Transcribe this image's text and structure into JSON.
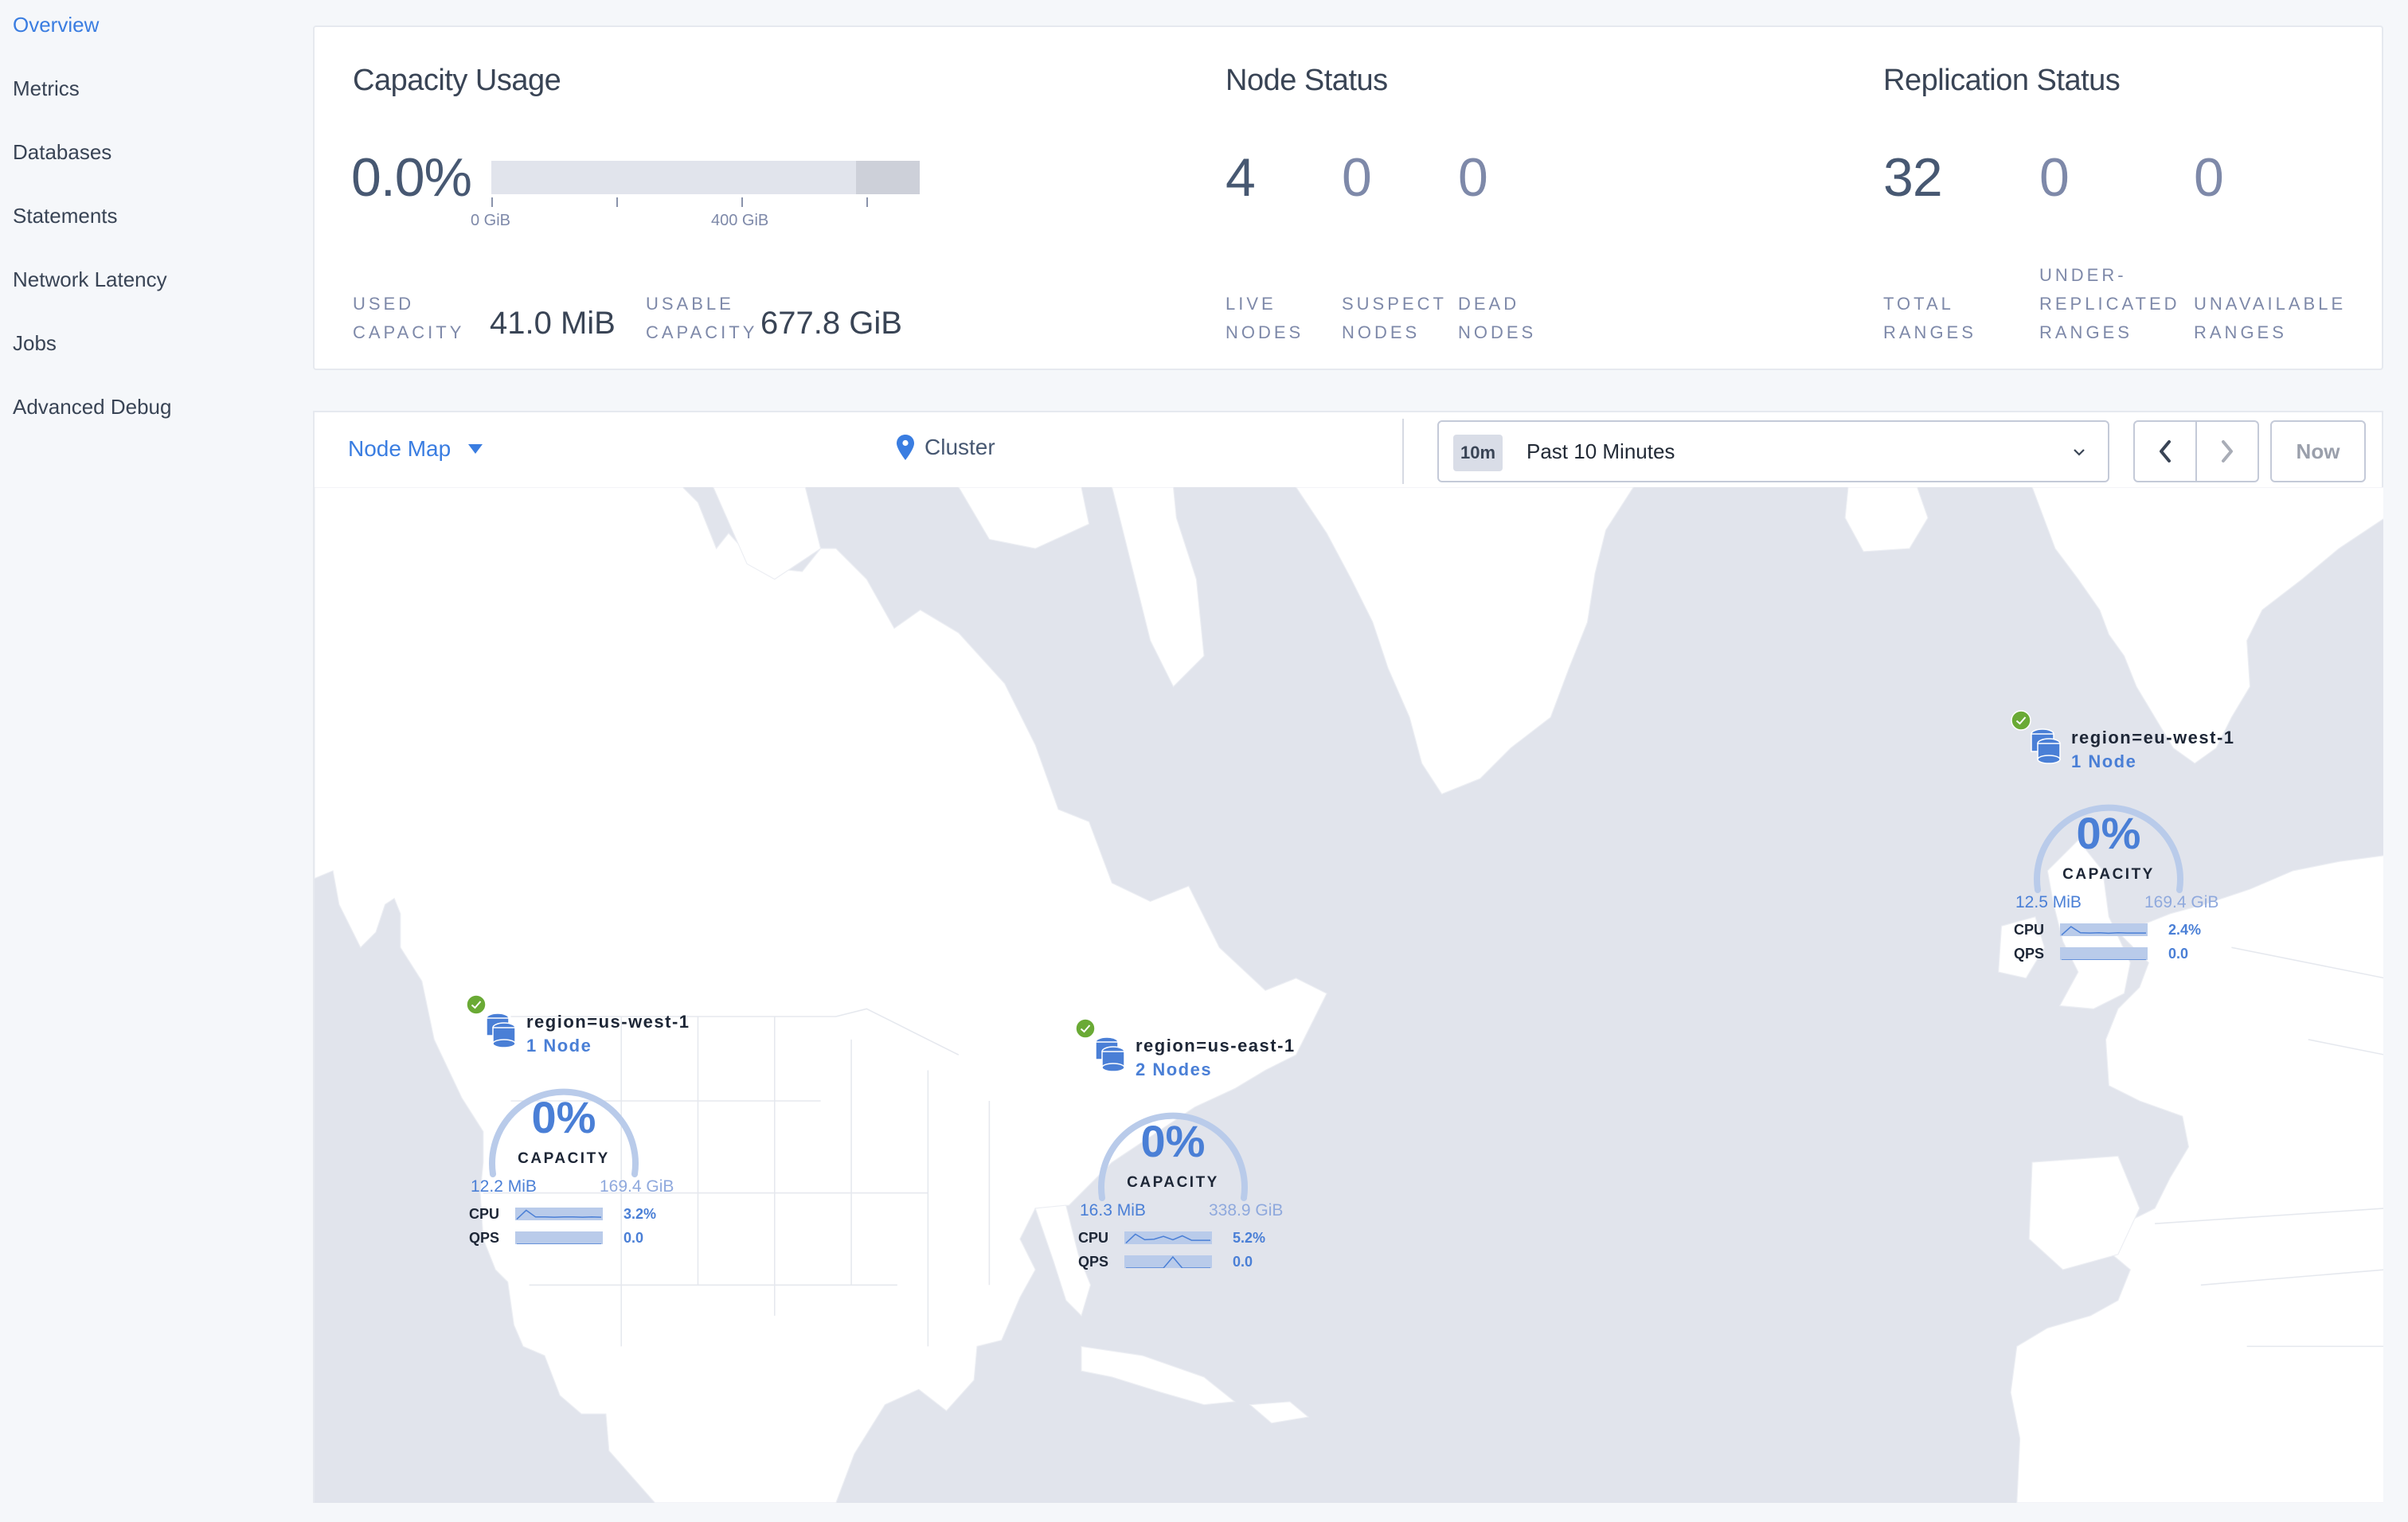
{
  "sidebar": {
    "items": [
      {
        "label": "Overview",
        "active": true
      },
      {
        "label": "Metrics",
        "active": false
      },
      {
        "label": "Databases",
        "active": false
      },
      {
        "label": "Statements",
        "active": false
      },
      {
        "label": "Network Latency",
        "active": false
      },
      {
        "label": "Jobs",
        "active": false
      },
      {
        "label": "Advanced Debug",
        "active": false
      }
    ]
  },
  "capacity": {
    "title": "Capacity Usage",
    "percent": "0.0%",
    "bar_ticks": [
      "0 GiB",
      "400 GiB"
    ],
    "used_label_1": "USED",
    "used_label_2": "CAPACITY",
    "used_value": "41.0 MiB",
    "usable_label_1": "USABLE",
    "usable_label_2": "CAPACITY",
    "usable_value": "677.8 GiB",
    "used_fraction": 0.0
  },
  "node_status": {
    "title": "Node Status",
    "stats": [
      {
        "value": "4",
        "label_1": "LIVE",
        "label_2": "NODES"
      },
      {
        "value": "0",
        "label_1": "SUSPECT",
        "label_2": "NODES"
      },
      {
        "value": "0",
        "label_1": "DEAD",
        "label_2": "NODES"
      }
    ]
  },
  "replication_status": {
    "title": "Replication Status",
    "stats": [
      {
        "value": "32",
        "label_0": "",
        "label_1": "TOTAL",
        "label_2": "RANGES"
      },
      {
        "value": "0",
        "label_0": "UNDER-",
        "label_1": "REPLICATED",
        "label_2": "RANGES"
      },
      {
        "value": "0",
        "label_0": "",
        "label_1": "UNAVAILABLE",
        "label_2": "RANGES"
      }
    ]
  },
  "toolbar": {
    "map_select": "Node Map",
    "breadcrumb": "Cluster",
    "time_badge": "10m",
    "time_label": "Past 10 Minutes",
    "now_label": "Now"
  },
  "regions": [
    {
      "name": "region=us-west-1",
      "nodes": "1 Node",
      "status": "healthy",
      "capacity_pct": "0%",
      "capacity_label": "CAPACITY",
      "used": "12.2 MiB",
      "total": "169.4 GiB",
      "cpu_label": "CPU",
      "cpu": "3.2%",
      "qps_label": "QPS",
      "qps": "0.0",
      "cpu_spark": [
        0.1,
        0.9,
        0.3,
        0.3,
        0.28,
        0.3,
        0.3,
        0.28,
        0.3,
        0.28
      ],
      "qps_spark": [
        0,
        0,
        0,
        0,
        0,
        0,
        0,
        0,
        0,
        0
      ]
    },
    {
      "name": "region=us-east-1",
      "nodes": "2 Nodes",
      "status": "healthy",
      "capacity_pct": "0%",
      "capacity_label": "CAPACITY",
      "used": "16.3 MiB",
      "total": "338.9 GiB",
      "cpu_label": "CPU",
      "cpu": "5.2%",
      "qps_label": "QPS",
      "qps": "0.0",
      "cpu_spark": [
        0.1,
        0.9,
        0.4,
        0.45,
        0.7,
        0.4,
        0.75,
        0.35,
        0.35,
        0.35
      ],
      "qps_spark": [
        0,
        0,
        0,
        0,
        0,
        1,
        0,
        0,
        0,
        0
      ]
    },
    {
      "name": "region=eu-west-1",
      "nodes": "1 Node",
      "status": "healthy",
      "capacity_pct": "0%",
      "capacity_label": "CAPACITY",
      "used": "12.5 MiB",
      "total": "169.4 GiB",
      "cpu_label": "CPU",
      "cpu": "2.4%",
      "qps_label": "QPS",
      "qps": "0.0",
      "cpu_spark": [
        0.1,
        0.85,
        0.3,
        0.28,
        0.3,
        0.26,
        0.3,
        0.28,
        0.28,
        0.28
      ],
      "qps_spark": [
        0,
        0,
        0,
        0,
        0,
        0,
        0,
        0,
        0,
        0
      ]
    }
  ],
  "colors": {
    "accent": "#3a7de1",
    "region_blue": "#4a7fd6",
    "healthy_green": "#6aaa35",
    "ocean": "#e1e4ec",
    "land": "#ffffff"
  }
}
